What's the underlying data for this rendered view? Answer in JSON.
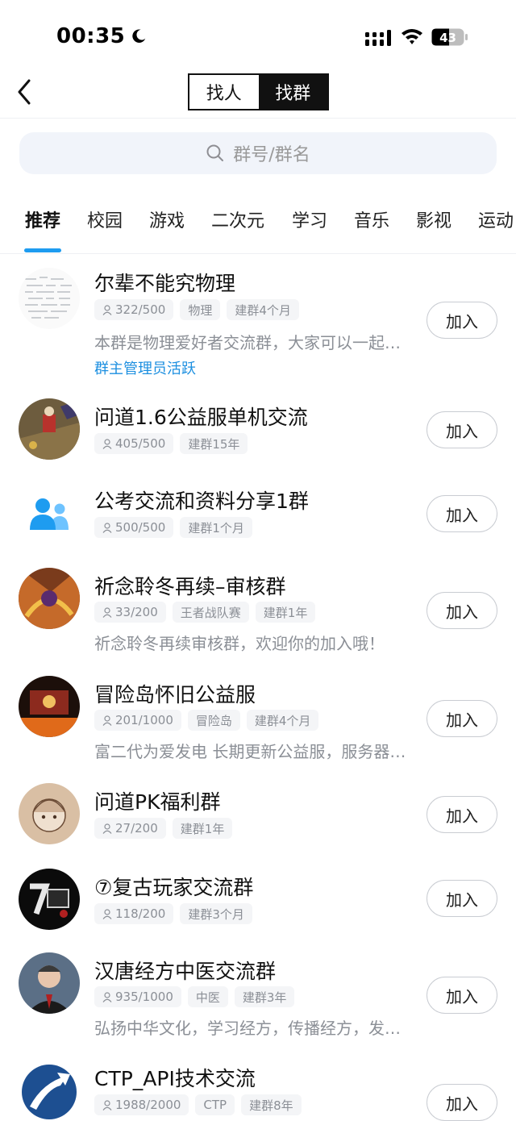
{
  "status": {
    "time": "00:35",
    "battery": "43"
  },
  "header": {
    "segments": [
      "找人",
      "找群"
    ],
    "active_segment": 1
  },
  "search": {
    "placeholder": "群号/群名"
  },
  "tabs": [
    "推荐",
    "校园",
    "游戏",
    "二次元",
    "学习",
    "音乐",
    "影视",
    "运动"
  ],
  "accent_color": "#1e9cf0",
  "join_label": "加入",
  "groups": [
    {
      "name": "尔辈不能究物理",
      "members": "322/500",
      "tags": [
        "物理",
        "建群4个月"
      ],
      "desc": "本群是物理爱好者交流群，大家可以一起…",
      "badge": "群主管理员活跃"
    },
    {
      "name": "问道1.6公益服单机交流",
      "members": "405/500",
      "tags": [
        "建群15年"
      ]
    },
    {
      "name": "公考交流和资料分享1群",
      "members": "500/500",
      "tags": [
        "建群1个月"
      ]
    },
    {
      "name": "祈念聆冬再续–审核群",
      "members": "33/200",
      "tags": [
        "王者战队赛",
        "建群1年"
      ],
      "desc": "祈念聆冬再续审核群，欢迎你的加入哦！"
    },
    {
      "name": "冒险岛怀旧公益服",
      "members": "201/1000",
      "tags": [
        "冒险岛",
        "建群4个月"
      ],
      "desc": "富二代为爱发电 长期更新公益服，服务器…"
    },
    {
      "name": "问道PK福利群",
      "members": "27/200",
      "tags": [
        "建群1年"
      ]
    },
    {
      "name": "⑦复古玩家交流群",
      "members": "118/200",
      "tags": [
        "建群3个月"
      ]
    },
    {
      "name": "汉唐经方中医交流群",
      "members": "935/1000",
      "tags": [
        "中医",
        "建群3年"
      ],
      "desc": "弘扬中华文化，学习经方，传播经方，发…"
    },
    {
      "name": "CTP_API技术交流",
      "members": "1988/2000",
      "tags": [
        "CTP",
        "建群8年"
      ]
    }
  ]
}
